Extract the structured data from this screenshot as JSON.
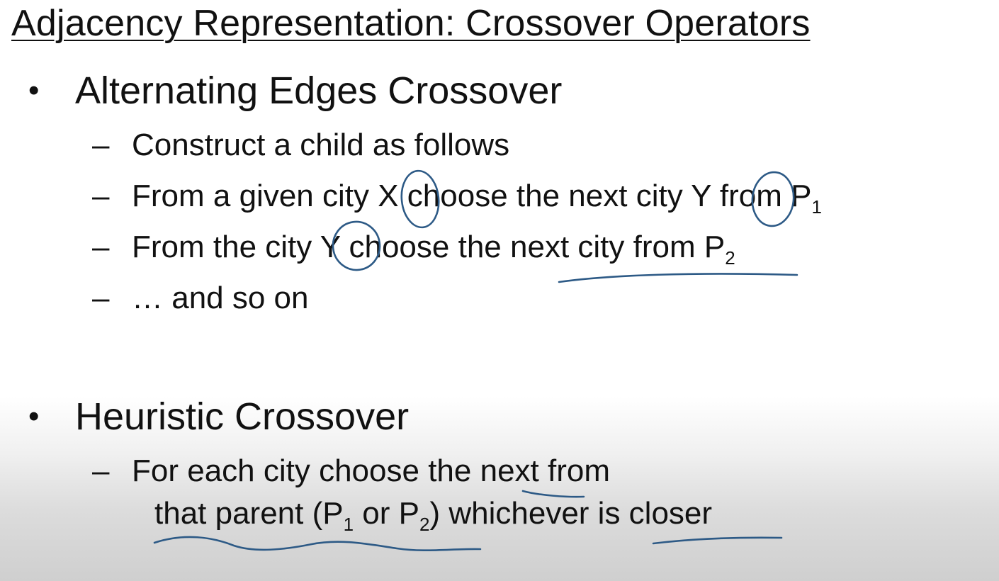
{
  "title": "Adjacency Representation: Crossover Operators",
  "bullets": [
    {
      "text": "Alternating Edges Crossover",
      "items": [
        {
          "parts": [
            "Construct a child as follows"
          ]
        },
        {
          "parts": [
            "From a given city ",
            "X",
            " choose the next city ",
            "Y",
            " from P",
            "1"
          ]
        },
        {
          "parts": [
            "From the city ",
            "Y",
            " choose the ",
            "next city from P",
            "2"
          ]
        },
        {
          "parts": [
            "… and so on"
          ]
        }
      ]
    },
    {
      "text": "Heuristic Crossover",
      "items": [
        {
          "line1": [
            "For each city choose the ",
            "next",
            " from"
          ],
          "line2": [
            "that parent (P",
            "1",
            " or P",
            "2",
            ")",
            " whichever ",
            "is closer"
          ]
        }
      ]
    }
  ],
  "symbols": {
    "bullet": "•",
    "dash": "–"
  },
  "ink_color": "#2d5a86"
}
